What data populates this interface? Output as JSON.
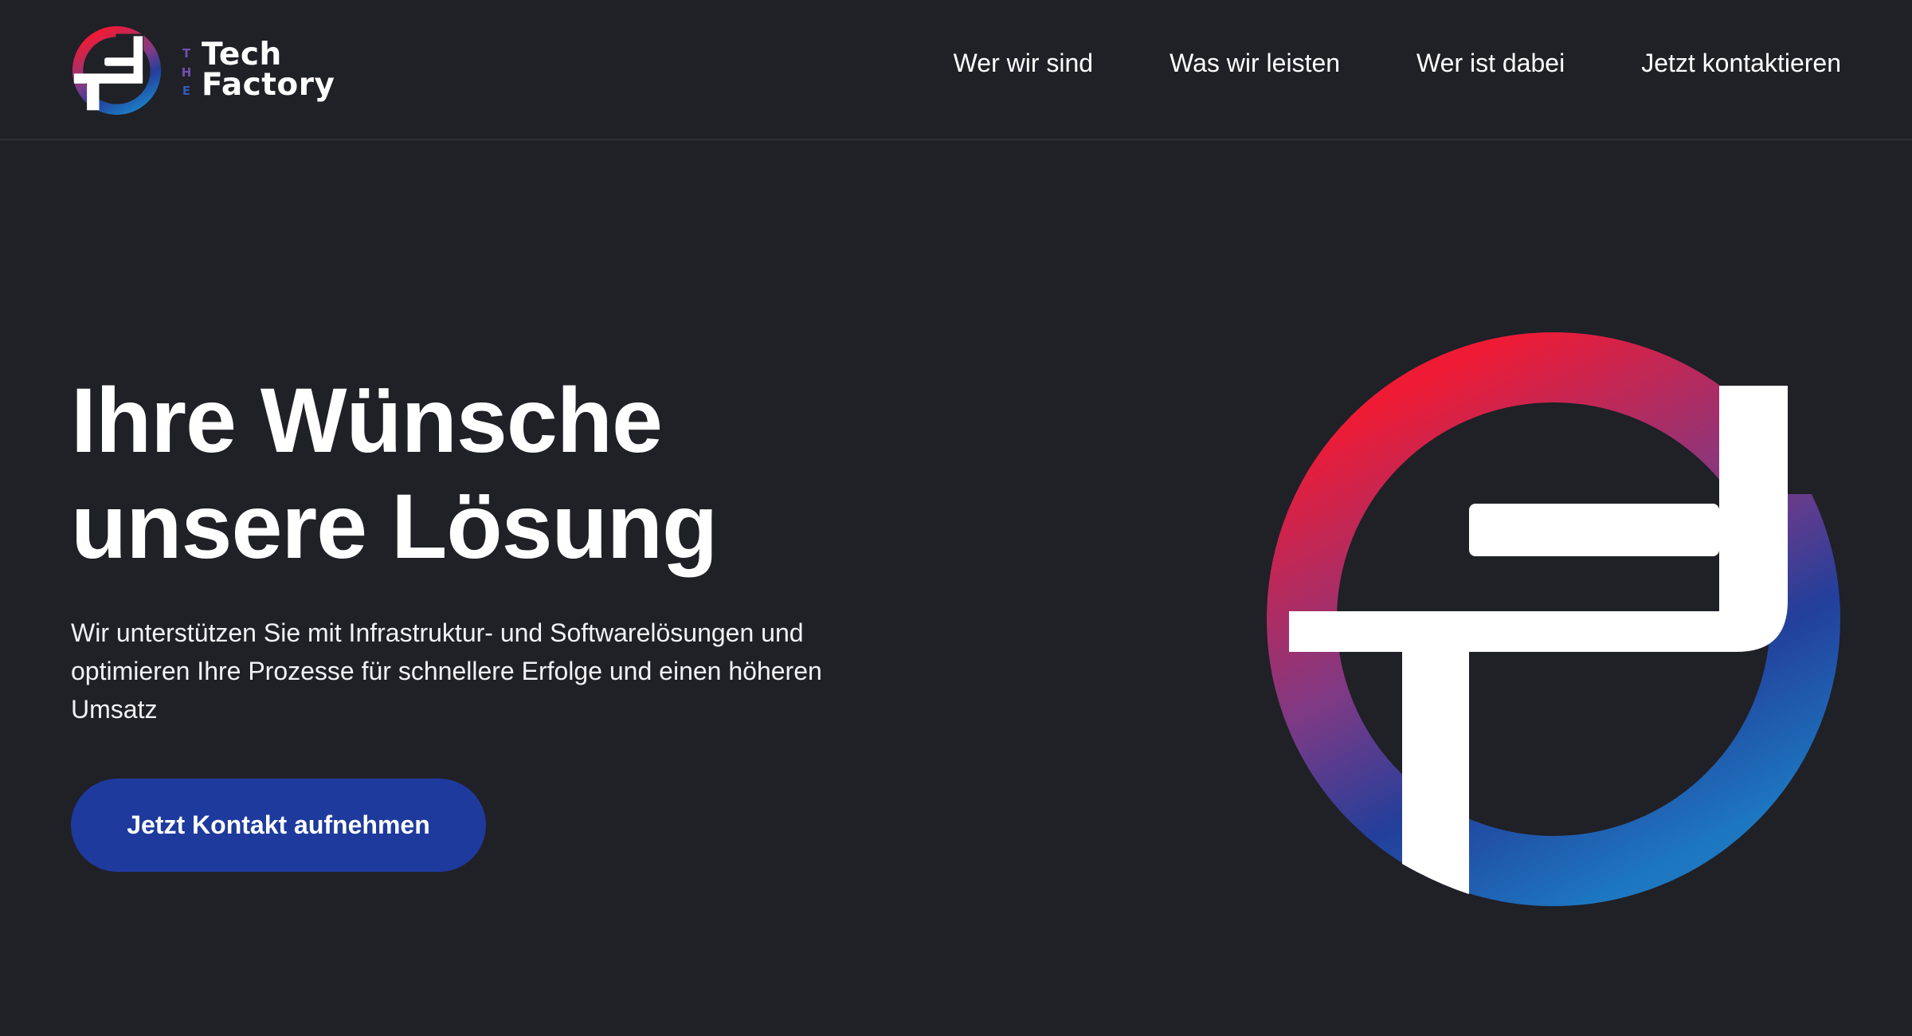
{
  "brand": {
    "small_label": "THE",
    "line1": "Tech",
    "line2": "Factory",
    "mark_letters": "TF"
  },
  "nav": {
    "items": [
      "Wer wir sind",
      "Was wir leisten",
      "Wer ist dabei",
      "Jetzt kontaktieren"
    ]
  },
  "hero": {
    "title_line1": "Ihre Wünsche",
    "title_line2": "unsere Lösung",
    "description": "Wir unterstützen Sie mit Infrastruktur- und Softwarelösungen und optimieren Ihre Prozesse für schnellere Erfolge und einen höheren Umsatz",
    "cta_label": "Jetzt Kontakt aufnehmen"
  },
  "colors": {
    "background": "#202027",
    "header_border": "#2f2f37",
    "accent": "#1e3a9d",
    "gradient_red": "#ef1b35",
    "gradient_purple": "#7c3a86",
    "gradient_blue": "#233f9b",
    "gradient_light_blue": "#1d78c1"
  },
  "icons": {
    "brand_logo": "tf-monogram-icon",
    "hero_logo": "tf-monogram-icon"
  }
}
